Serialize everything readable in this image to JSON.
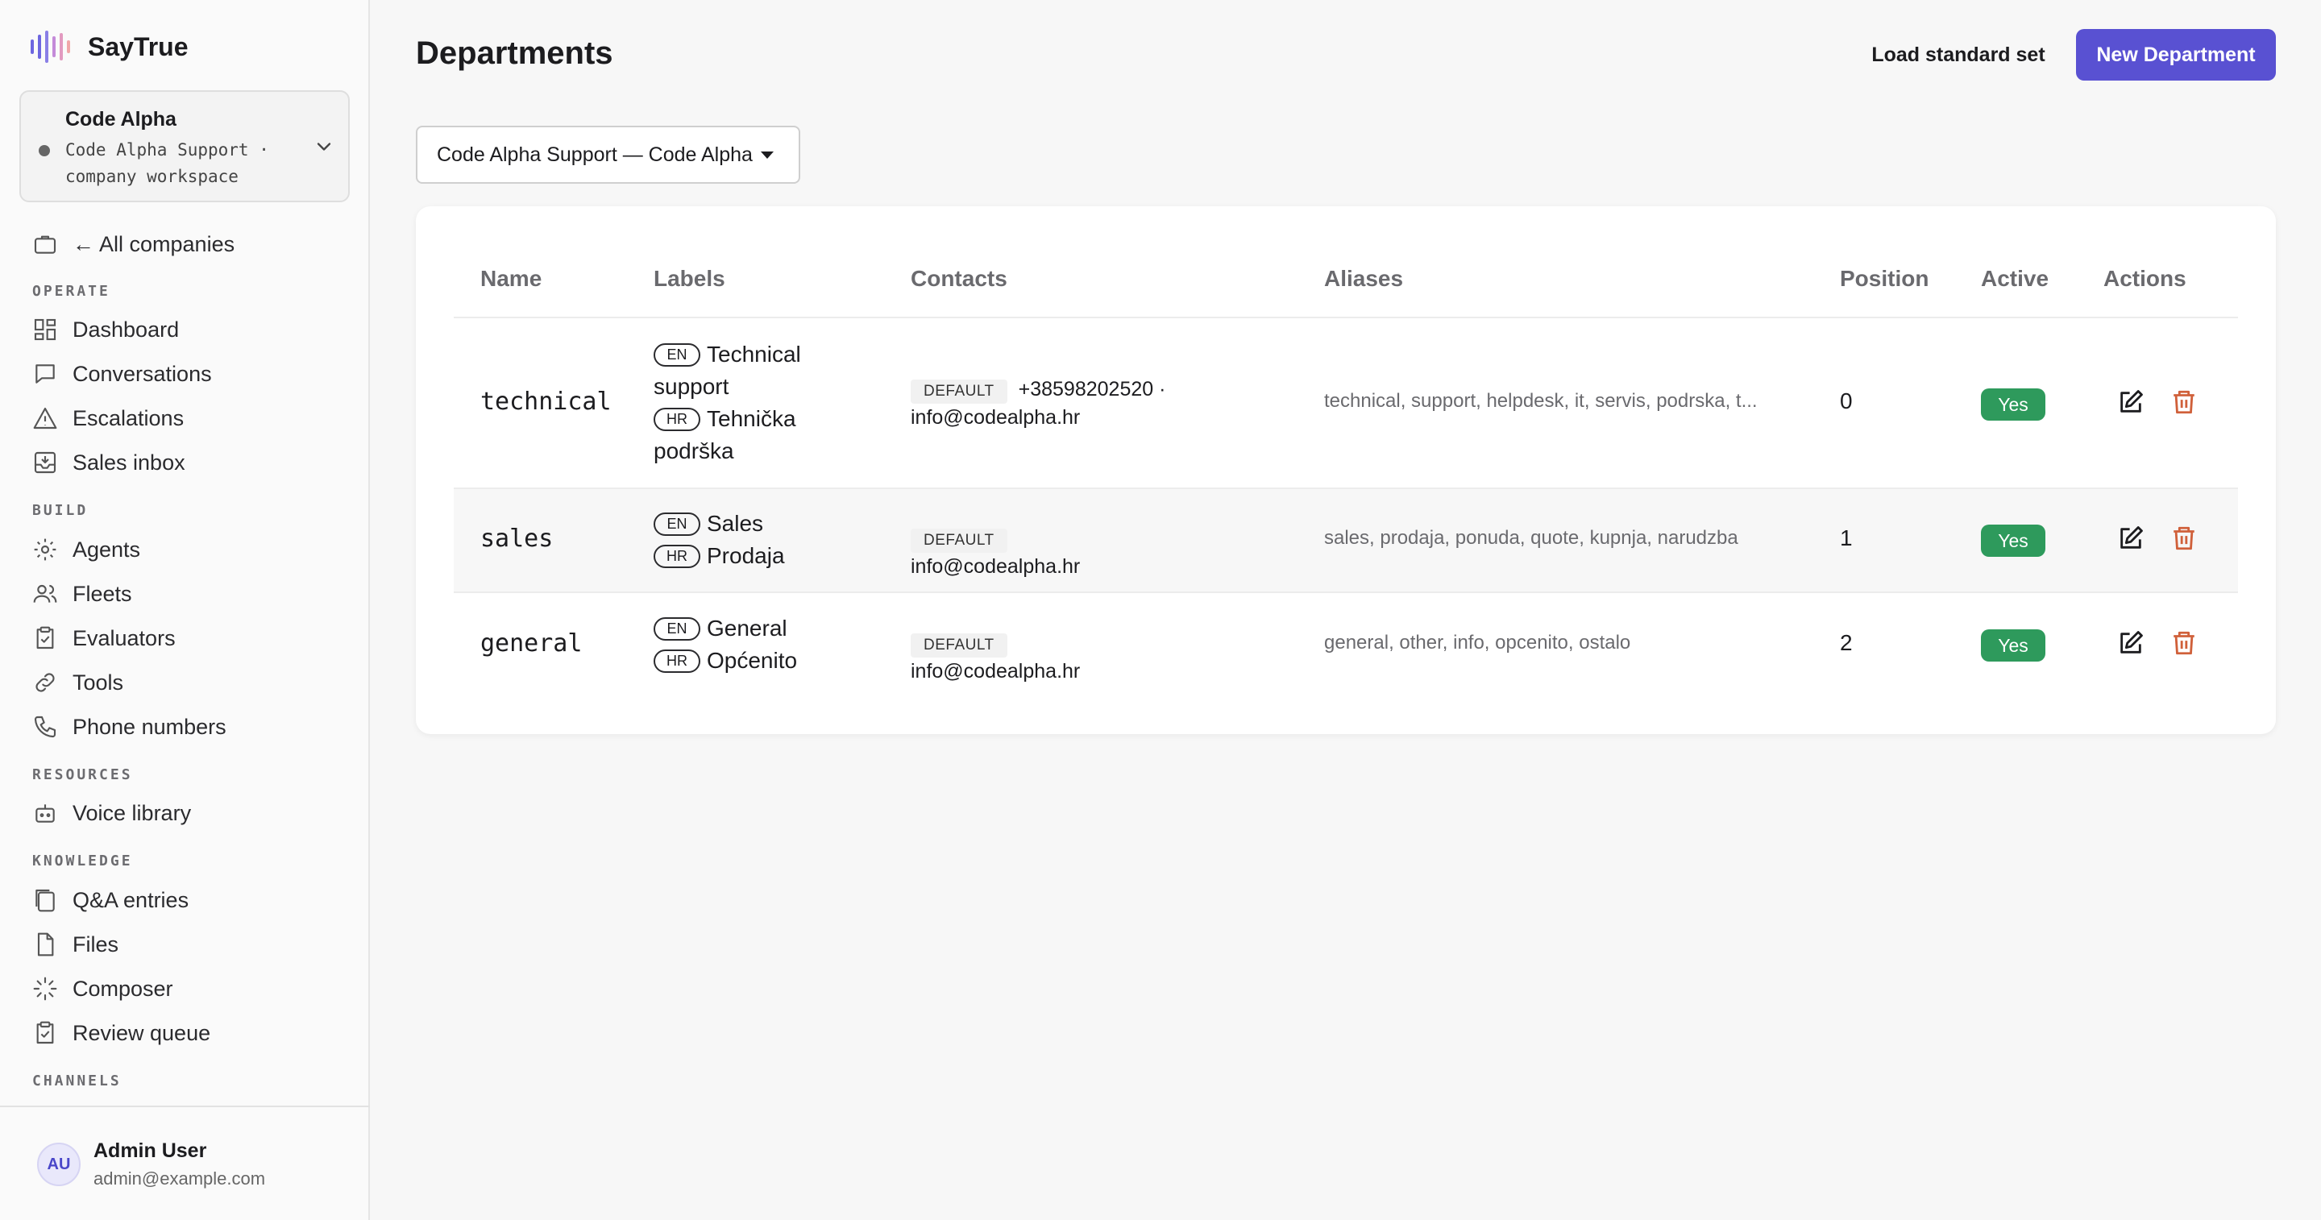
{
  "brand": {
    "name": "SayTrue"
  },
  "company": {
    "name": "Code Alpha",
    "subtitle": "Code Alpha Support · company workspace"
  },
  "nav": {
    "back_label": "← All companies",
    "sections": {
      "operate": "OPERATE",
      "build": "BUILD",
      "resources": "RESOURCES",
      "knowledge": "KNOWLEDGE",
      "channels": "CHANNELS"
    },
    "items": {
      "dashboard": "Dashboard",
      "conversations": "Conversations",
      "escalations": "Escalations",
      "sales_inbox": "Sales inbox",
      "agents": "Agents",
      "fleets": "Fleets",
      "evaluators": "Evaluators",
      "tools": "Tools",
      "phone_numbers": "Phone numbers",
      "voice_library": "Voice library",
      "qa_entries": "Q&A entries",
      "files": "Files",
      "composer": "Composer",
      "review_queue": "Review queue"
    }
  },
  "user": {
    "initials": "AU",
    "name": "Admin User",
    "email": "admin@example.com"
  },
  "page": {
    "title": "Departments",
    "load_standard_label": "Load standard set",
    "new_department_label": "New Department",
    "workspace_select": "Code Alpha Support — Code Alpha"
  },
  "table": {
    "headers": {
      "name": "Name",
      "labels": "Labels",
      "contacts": "Contacts",
      "aliases": "Aliases",
      "position": "Position",
      "active": "Active",
      "actions": "Actions"
    },
    "rows": [
      {
        "name": "technical",
        "label_en_tag": "EN",
        "label_en": "Technical support",
        "label_hr_tag": "HR",
        "label_hr": "Tehnička podrška",
        "contact_tag": "DEFAULT",
        "contact": "+38598202520 · info@codealpha.hr",
        "aliases": "technical, support, helpdesk, it, servis, podrska, t...",
        "position": "0",
        "active": "Yes"
      },
      {
        "name": "sales",
        "label_en_tag": "EN",
        "label_en": "Sales",
        "label_hr_tag": "HR",
        "label_hr": "Prodaja",
        "contact_tag": "DEFAULT",
        "contact": "info@codealpha.hr",
        "aliases": "sales, prodaja, ponuda, quote, kupnja, narudzba",
        "position": "1",
        "active": "Yes"
      },
      {
        "name": "general",
        "label_en_tag": "EN",
        "label_en": "General",
        "label_hr_tag": "HR",
        "label_hr": "Općenito",
        "contact_tag": "DEFAULT",
        "contact": "info@codealpha.hr",
        "aliases": "general, other, info, opcenito, ostalo",
        "position": "2",
        "active": "Yes"
      }
    ]
  },
  "colors": {
    "accent": "#5951d2",
    "active_badge": "#2e9a5c",
    "delete_icon": "#d0603a"
  },
  "icons": {
    "brand": "waveform-icon",
    "back": "briefcase-icon",
    "edit": "edit-icon",
    "delete": "trash-icon"
  }
}
